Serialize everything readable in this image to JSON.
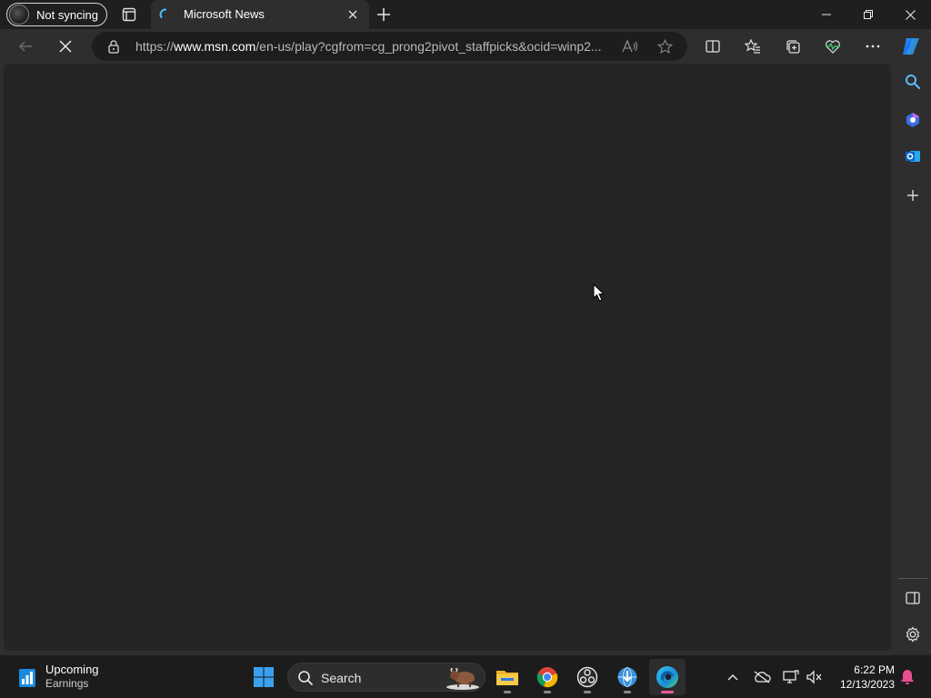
{
  "browser": {
    "profile_label": "Not syncing",
    "tab": {
      "title": "Microsoft News"
    },
    "address": {
      "prefix": "https://",
      "host": "www.msn.com",
      "path": "/en-us/play?cgfrom=cg_prong2pivot_staffpicks&ocid=winp2..."
    },
    "icons": {
      "tab_actions": "tab-actions-icon",
      "new_tab": "plus-icon",
      "back": "back-arrow-icon",
      "stop": "stop-loading-icon",
      "lock": "lock-icon",
      "read_aloud": "read-aloud-icon",
      "favorite": "star-icon",
      "split_screen": "split-screen-icon",
      "favorites": "favorites-list-icon",
      "collections": "collections-icon",
      "performance": "heart-pulse-icon",
      "more": "ellipsis-icon",
      "copilot": "copilot-icon"
    },
    "sidebar": [
      "search-icon",
      "copilot-icon",
      "outlook-icon",
      "add-icon",
      "hide-sidebar-icon",
      "settings-icon"
    ]
  },
  "taskbar": {
    "widget": {
      "title": "Upcoming",
      "subtitle": "Earnings"
    },
    "search_label": "Search",
    "clock": {
      "time": "6:22 PM",
      "date": "12/13/2023"
    }
  },
  "colors": {
    "titlebar": "#1f1f1f",
    "toolbar": "#2e2e2e",
    "page_background": "#252525",
    "taskbar": "#1c1c1c",
    "accent_edge": "#1aa0e8"
  }
}
